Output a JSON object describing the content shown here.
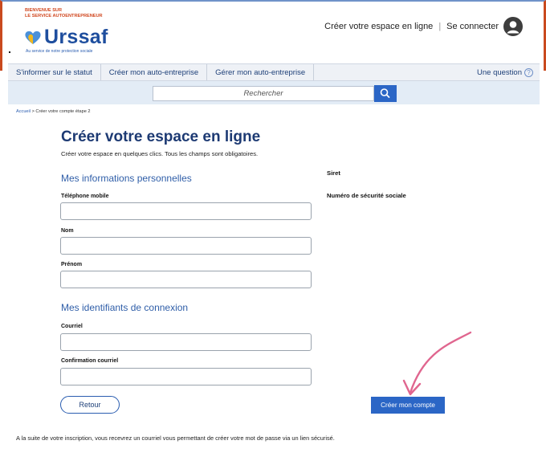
{
  "header": {
    "welcome_line1": "BIENVENUE SUR",
    "welcome_line2": "LE SERVICE AUTOENTREPRENEUR",
    "logo_text": "Urssaf",
    "tagline": "Au service de notre protection sociale",
    "create_space_link": "Créer votre espace en ligne",
    "separator": "|",
    "login_link": "Se connecter",
    "colors": {
      "brand_orange": "#d0471f",
      "brand_blue": "#1e4e9e"
    }
  },
  "nav": {
    "items": [
      {
        "label": "S'informer sur le statut"
      },
      {
        "label": "Créer mon auto-entreprise"
      },
      {
        "label": "Gérer mon auto-entreprise"
      }
    ],
    "question_label": "Une question",
    "question_icon": "?"
  },
  "search": {
    "placeholder": "Rechercher",
    "icon": "search-icon"
  },
  "breadcrumb": {
    "home": "Accueil",
    "separator": " > ",
    "current": "Créer votre compte étape 2"
  },
  "form": {
    "title": "Créer votre espace en ligne",
    "intro": "Créer votre espace en quelques clics. Tous les champs sont obligatoires.",
    "section_personal": "Mes informations personnelles",
    "label_phone": "Téléphone mobile",
    "label_lastname": "Nom",
    "label_firstname": "Prénom",
    "section_login": "Mes identifiants de connexion",
    "label_email": "Courriel",
    "label_email_confirm": "Confirmation courriel",
    "values": {
      "phone": "",
      "lastname": "",
      "firstname": "",
      "email": "",
      "email_confirm": ""
    }
  },
  "side": {
    "siret_label": "Siret",
    "ssn_label": "Numéro de sécurité sociale"
  },
  "actions": {
    "back_label": "Retour",
    "create_label": "Créer mon compte",
    "accent_color": "#2b66c6",
    "arrow_color": "#e0668f"
  },
  "footer": {
    "note": "A la suite de votre inscription, vous recevrez un courriel vous permettant de créer votre mot de passe via un lien sécurisé."
  }
}
